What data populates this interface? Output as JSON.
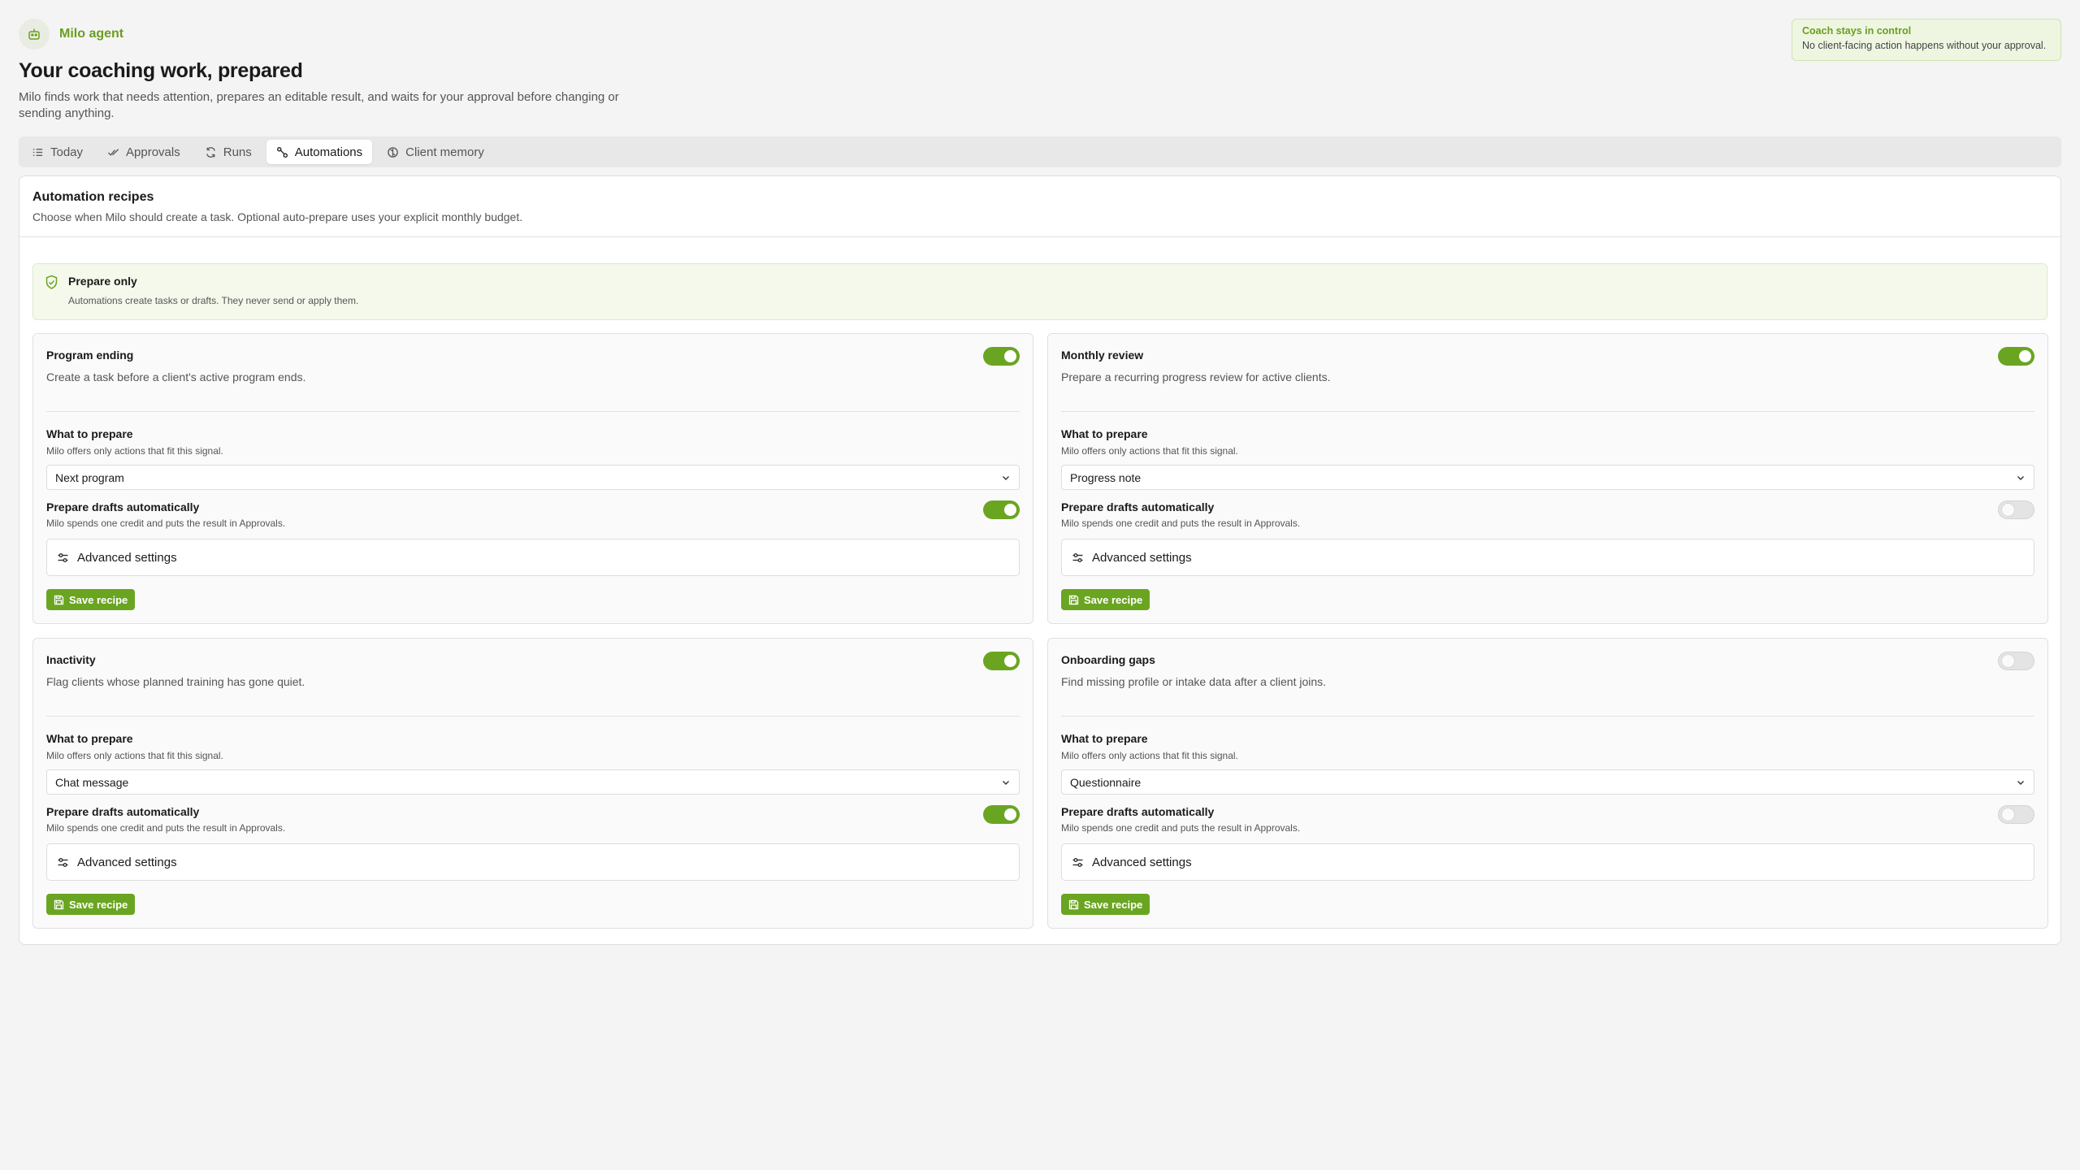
{
  "brand": {
    "name": "Milo agent",
    "icon": "robot-icon"
  },
  "header": {
    "title": "Your coaching work, prepared",
    "description": "Milo finds work that needs attention, prepares an editable result, and waits for your approval before changing or sending anything."
  },
  "control_note": {
    "title": "Coach stays in control",
    "text": "No client-facing action happens without your approval."
  },
  "tabs": [
    {
      "label": "Today",
      "icon": "list-icon",
      "active": false
    },
    {
      "label": "Approvals",
      "icon": "check-double-icon",
      "active": false
    },
    {
      "label": "Runs",
      "icon": "refresh-icon",
      "active": false
    },
    {
      "label": "Automations",
      "icon": "workflow-icon",
      "active": true
    },
    {
      "label": "Client memory",
      "icon": "brain-icon",
      "active": false
    }
  ],
  "panel": {
    "title": "Automation recipes",
    "subtitle": "Choose when Milo should create a task. Optional auto-prepare uses your explicit monthly budget."
  },
  "notice": {
    "title": "Prepare only",
    "text": "Automations create tasks or drafts. They never send or apply them."
  },
  "labels": {
    "what_to_prepare": "What to prepare",
    "what_help": "Milo offers only actions that fit this signal.",
    "auto_title": "Prepare drafts automatically",
    "auto_help": "Milo spends one credit and puts the result in Approvals.",
    "advanced": "Advanced settings",
    "save": "Save recipe"
  },
  "recipes": [
    {
      "title": "Program ending",
      "description": "Create a task before a client's active program ends.",
      "enabled": true,
      "action": "Next program",
      "auto_prepare": true
    },
    {
      "title": "Monthly review",
      "description": "Prepare a recurring progress review for active clients.",
      "enabled": true,
      "action": "Progress note",
      "auto_prepare": false
    },
    {
      "title": "Inactivity",
      "description": "Flag clients whose planned training has gone quiet.",
      "enabled": true,
      "action": "Chat message",
      "auto_prepare": true
    },
    {
      "title": "Onboarding gaps",
      "description": "Find missing profile or intake data after a client joins.",
      "enabled": false,
      "action": "Questionnaire",
      "auto_prepare": false
    }
  ],
  "colors": {
    "accent": "#6aa521",
    "accent_text": "#6a9e1f",
    "notice_bg": "#f4f9ec"
  }
}
